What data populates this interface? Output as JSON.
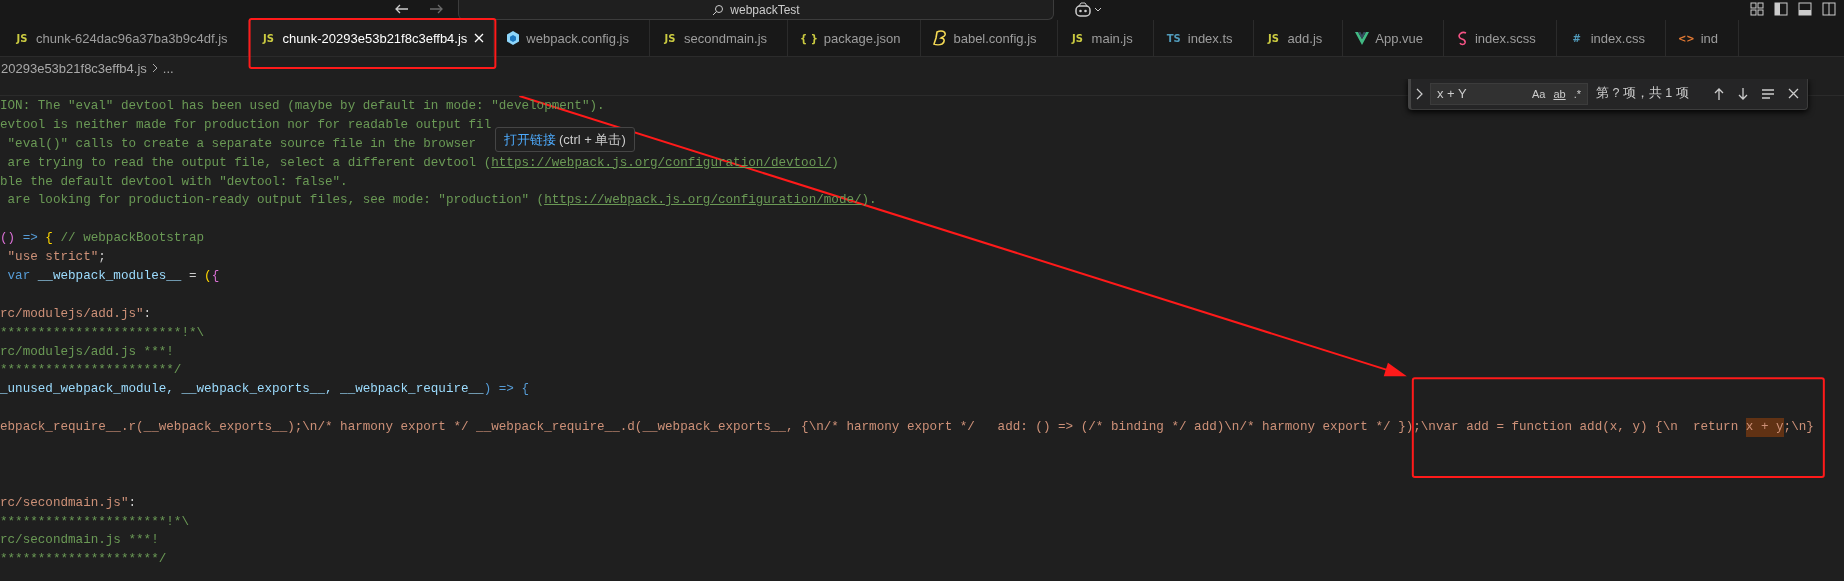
{
  "title_bar": {
    "search": "webpackTest"
  },
  "tabs": [
    {
      "label": "chunk-624dac96a37ba3b9c4df.js",
      "kind": "js",
      "badge": "JS",
      "selected": false,
      "marked": false
    },
    {
      "label": "chunk-20293e53b21f8c3effb4.js",
      "kind": "js",
      "badge": "JS",
      "selected": true,
      "marked": true
    },
    {
      "label": "webpack.config.js",
      "kind": "webpack",
      "selected": false,
      "marked": false
    },
    {
      "label": "secondmain.js",
      "kind": "js",
      "badge": "JS",
      "selected": false,
      "marked": false
    },
    {
      "label": "package.json",
      "kind": "json",
      "badge": "{ }",
      "selected": false,
      "marked": false
    },
    {
      "label": "babel.config.js",
      "kind": "babel",
      "selected": false,
      "marked": false
    },
    {
      "label": "main.js",
      "kind": "js",
      "badge": "JS",
      "selected": false,
      "marked": false
    },
    {
      "label": "index.ts",
      "kind": "ts",
      "badge": "TS",
      "selected": false,
      "marked": false
    },
    {
      "label": "add.js",
      "kind": "js",
      "badge": "JS",
      "selected": false,
      "marked": false
    },
    {
      "label": "App.vue",
      "kind": "vue",
      "selected": false,
      "marked": false
    },
    {
      "label": "index.scss",
      "kind": "scss",
      "selected": false,
      "marked": false
    },
    {
      "label": "index.css",
      "kind": "css",
      "badge": "#",
      "selected": false,
      "marked": false
    },
    {
      "label": "ind",
      "kind": "html",
      "badge": "<>",
      "selected": false,
      "marked": false
    }
  ],
  "breadcrumb": [
    "20293e53b21f8c3effb4.js",
    "..."
  ],
  "find": {
    "value": "x + Y",
    "options": [
      "Aa",
      "ab",
      ".*"
    ],
    "result": "第 ? 项，共 1 项"
  },
  "tooltip": {
    "action": "打开链接",
    "hint": "(ctrl + 单击)"
  },
  "code_lines": [
    {
      "kind": "code",
      "tokens": [
        {
          "kind": "comment",
          "text": "ION: The \"eval\" devtool has been used (maybe by default in mode: \"development\")."
        }
      ]
    },
    {
      "kind": "code",
      "tokens": [
        {
          "kind": "comment",
          "text": "evtool is neither made for production nor for readable output fil"
        }
      ]
    },
    {
      "kind": "code",
      "tokens": [
        {
          "kind": "comment",
          "text": " \"eval()\" calls to create a separate source file in the browser"
        }
      ]
    },
    {
      "kind": "code",
      "tokens": [
        {
          "kind": "comment",
          "text": " are trying to read the output file, select a different devtool ("
        },
        {
          "kind": "link",
          "text": "https://webpack.js.org/configuration/devtool/"
        },
        {
          "kind": "comment",
          "text": ")"
        }
      ]
    },
    {
      "kind": "code",
      "tokens": [
        {
          "kind": "comment",
          "text": "ble the default devtool with \"devtool: false\"."
        }
      ]
    },
    {
      "kind": "code",
      "tokens": [
        {
          "kind": "comment",
          "text": " are looking for production-ready output files, see mode: \"production\" ("
        },
        {
          "kind": "link",
          "text": "https://webpack.js.org/configuration/mode/"
        },
        {
          "kind": "comment",
          "text": ")."
        }
      ]
    },
    {
      "kind": "blank"
    },
    {
      "kind": "code",
      "tokens": [
        {
          "kind": "brace1",
          "text": "()"
        },
        {
          "kind": "keyword",
          "text": " => "
        },
        {
          "kind": "brace2",
          "text": "{"
        },
        {
          "kind": "comment",
          "text": " // webpackBootstrap"
        }
      ]
    },
    {
      "kind": "code",
      "tokens": [
        {
          "kind": "string",
          "text": " \"use strict\""
        },
        {
          "kind": "plain",
          "text": ";"
        }
      ]
    },
    {
      "kind": "code",
      "tokens": [
        {
          "kind": "keyword",
          "text": " var "
        },
        {
          "kind": "variable",
          "text": "__webpack_modules__"
        },
        {
          "kind": "plain",
          "text": " = "
        },
        {
          "kind": "brace2",
          "text": "("
        },
        {
          "kind": "brace1",
          "text": "{"
        }
      ]
    },
    {
      "kind": "blank"
    },
    {
      "kind": "code",
      "tokens": [
        {
          "kind": "string",
          "text": "rc/modulejs/add.js\""
        },
        {
          "kind": "plain",
          "text": ":"
        }
      ]
    },
    {
      "kind": "code",
      "tokens": [
        {
          "kind": "comment",
          "text": "************************!*\\"
        }
      ]
    },
    {
      "kind": "code",
      "tokens": [
        {
          "kind": "comment",
          "text": "rc/modulejs/add.js ***!"
        }
      ]
    },
    {
      "kind": "code",
      "tokens": [
        {
          "kind": "comment",
          "text": "***********************/"
        }
      ]
    },
    {
      "kind": "code",
      "tokens": [
        {
          "kind": "variable",
          "text": "_unused_webpack_module, __webpack_exports__, __webpack_require__"
        },
        {
          "kind": "keyword",
          "text": ") => {"
        }
      ]
    },
    {
      "kind": "blank"
    },
    {
      "kind": "code",
      "tokens": [
        {
          "kind": "string",
          "text": "ebpack_require__.r(__webpack_exports__);\\n/* harmony export */ __webpack_require__.d(__webpack_exports__, {\\n/* harmony export */   add: () => (/* binding */ add)\\n/* harmony export */ });"
        },
        {
          "kind": "string",
          "text": "\\nvar add = function add(x, y) {\\n  return ",
          "marked": true
        },
        {
          "kind": "match",
          "text": "x + y",
          "marked": true
        },
        {
          "kind": "string",
          "text": ";\\n}",
          "marked": true
        }
      ]
    },
    {
      "kind": "blank"
    },
    {
      "kind": "blank"
    },
    {
      "kind": "blank"
    },
    {
      "kind": "code",
      "tokens": [
        {
          "kind": "string",
          "text": "rc/secondmain.js\""
        },
        {
          "kind": "plain",
          "text": ":"
        }
      ]
    },
    {
      "kind": "code",
      "tokens": [
        {
          "kind": "comment",
          "text": "**********************!*\\"
        }
      ]
    },
    {
      "kind": "code",
      "tokens": [
        {
          "kind": "comment",
          "text": "rc/secondmain.js ***!"
        }
      ]
    },
    {
      "kind": "code",
      "tokens": [
        {
          "kind": "comment",
          "text": "*********************/"
        }
      ]
    }
  ]
}
